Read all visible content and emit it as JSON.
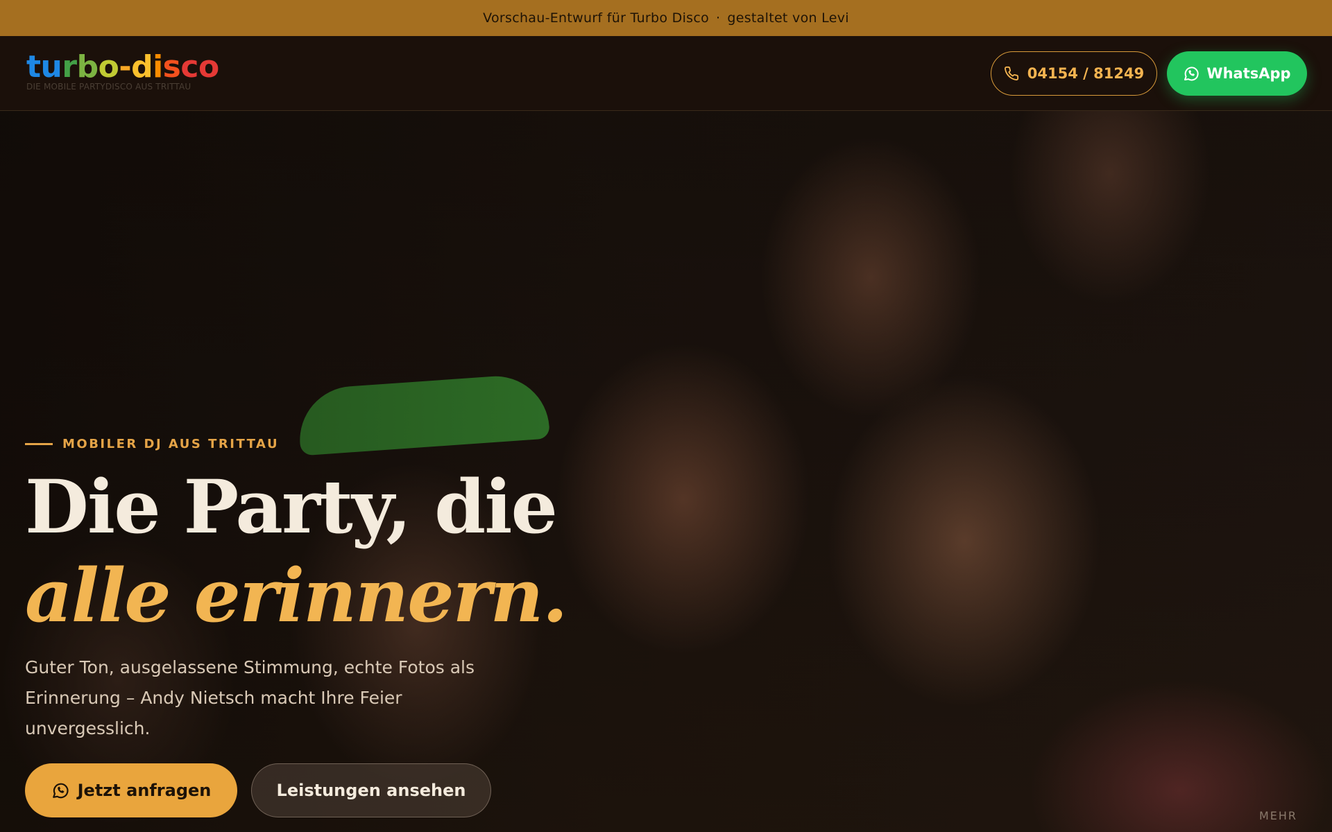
{
  "banner": {
    "text_left": "Vorschau-Entwurf für Turbo Disco",
    "separator": "·",
    "text_right": "gestaltet von Levi"
  },
  "header": {
    "logo": {
      "word": "turbo-disco",
      "letter_colors": [
        "#1e88e5",
        "#1e88e5",
        "#43a047",
        "#7cb342",
        "#c0ca33",
        "#f9a825",
        "#fbc02d",
        "#fb8c00",
        "#f4511e",
        "#e53935",
        "#e53935"
      ],
      "tagline": "DIE MOBILE PARTYDISCO AUS TRITTAU"
    },
    "phone_label": "04154 / 81249",
    "phone_icon": "phone-icon",
    "whatsapp_label": "WhatsApp",
    "whatsapp_icon": "whatsapp-icon"
  },
  "hero": {
    "eyebrow": "MOBILER DJ AUS TRITTAU",
    "headline_line1": "Die Party, die",
    "headline_line2": "alle erinnern.",
    "subtext": "Guter Ton, ausgelassene Stimmung, echte Fotos als Erinnerung – Andy Nietsch macht Ihre Feier unvergesslich.",
    "primary_cta": "Jetzt anfragen",
    "secondary_cta": "Leistungen ansehen",
    "more_label": "MEHR"
  },
  "colors": {
    "accent": "#e9a53d",
    "whatsapp_green": "#22c55e",
    "banner": "#a56f20",
    "header_bg": "#1b100a"
  }
}
